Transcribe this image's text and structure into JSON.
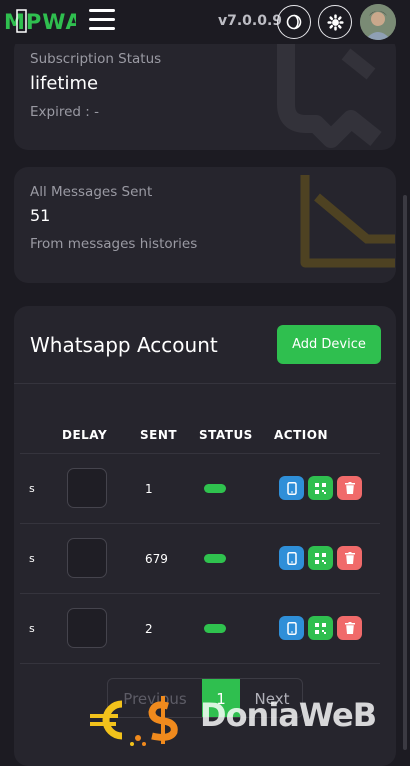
{
  "header": {
    "logo_text": "MPWA",
    "version": "v7.0.0.9"
  },
  "subscription": {
    "title": "Subscription Status",
    "value": "lifetime",
    "expired": "Expired : -"
  },
  "messages": {
    "title": "All Messages Sent",
    "value": "51",
    "note": "From messages histories"
  },
  "whatsapp": {
    "title": "Whatsapp Account",
    "add_label": "Add Device",
    "columns": [
      "DELAY",
      "SENT",
      "STATUS",
      "ACTION"
    ],
    "rows": [
      {
        "prefix": "s",
        "sent": "1"
      },
      {
        "prefix": "s",
        "sent": "679"
      },
      {
        "prefix": "s",
        "sent": "2"
      }
    ]
  },
  "pagination": {
    "prev": "Previous",
    "current": "1",
    "next": "Next"
  },
  "watermark": {
    "text": "DoniaWeB"
  },
  "colors": {
    "accent_green": "#2fbf4f",
    "action_blue": "#2f8fd8",
    "action_green": "#2fbf4f",
    "action_red": "#f06a6a",
    "chart_icon_gold": "#6b5520"
  },
  "icons": {
    "menu": "hamburger-icon",
    "theme": "moon-icon",
    "settings": "gear-icon",
    "row_actions": [
      "phone-icon",
      "qr-code-icon",
      "trash-icon"
    ]
  }
}
